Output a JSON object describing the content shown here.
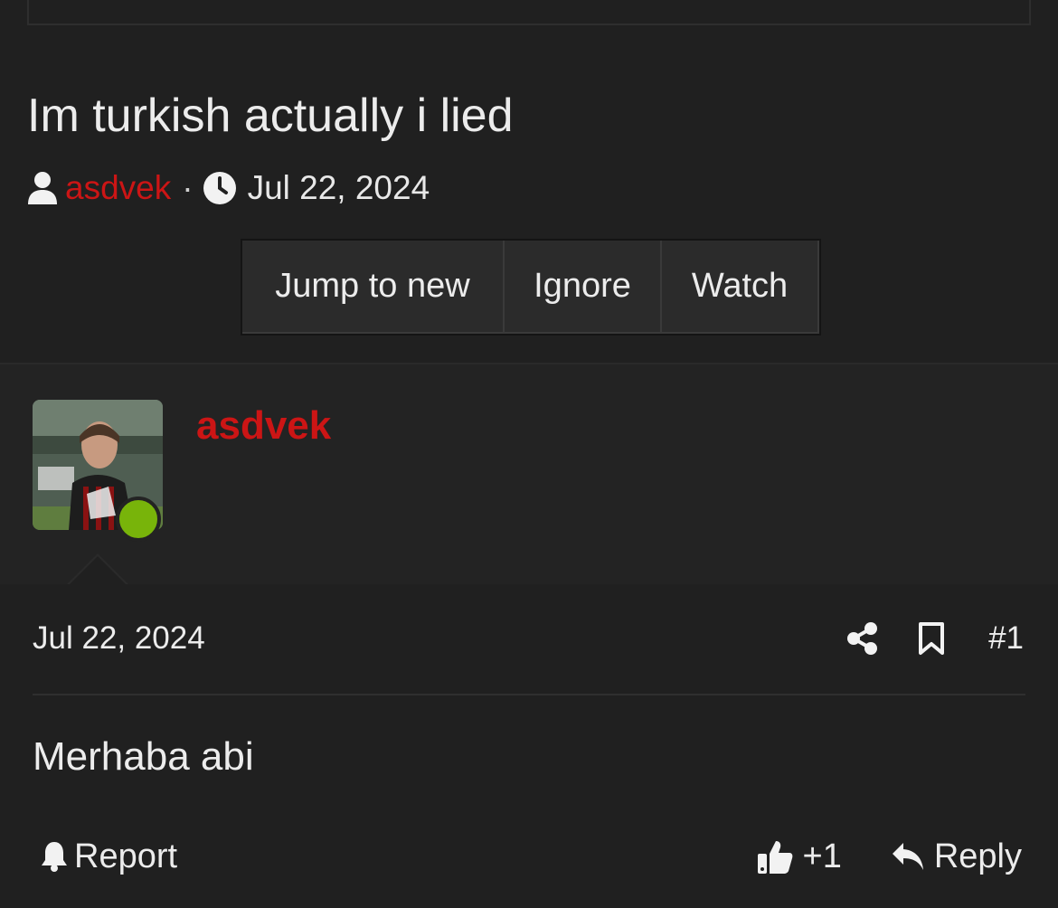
{
  "thread": {
    "title": "Im turkish actually i lied",
    "author": "asdvek",
    "separator": "·",
    "date": "Jul 22, 2024",
    "icons": {
      "author": "user-icon",
      "date": "clock-icon"
    }
  },
  "thread_buttons": {
    "jump": "Jump to new",
    "ignore": "Ignore",
    "watch": "Watch"
  },
  "post": {
    "author": "asdvek",
    "online": true,
    "date": "Jul 22, 2024",
    "number": "#1",
    "body": "Merhaba abi",
    "report_label": "Report",
    "like_label": "+1",
    "reply_label": "Reply",
    "icons": {
      "share": "share-icon",
      "bookmark": "bookmark-icon",
      "report": "bell-icon",
      "like": "thumbs-up-icon",
      "reply": "reply-icon"
    }
  },
  "colors": {
    "background": "#202020",
    "accent_red": "#cc1515",
    "online_green": "#78b40a",
    "text": "#ececec"
  }
}
